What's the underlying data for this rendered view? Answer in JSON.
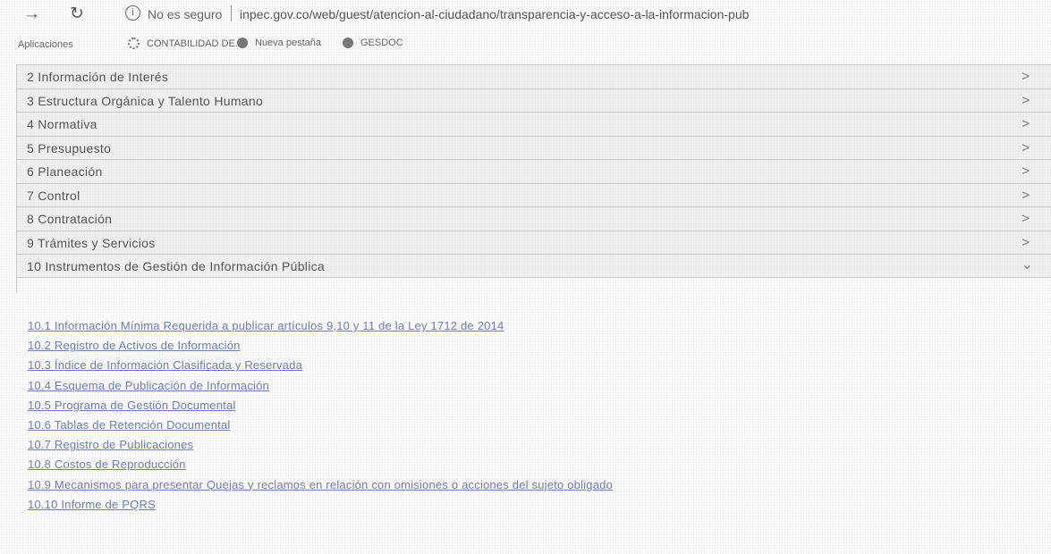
{
  "browser": {
    "back_icon": "back-arrow-icon",
    "reload_icon": "reload-icon",
    "security_text": "No es seguro",
    "url_main": "inpec.gov.co/web/guest/atencion-al-ciudadano/transparencia-y-acceso-a-la-informacion-pub",
    "bookmarks": {
      "apps_label": "Aplicaciones",
      "items": [
        {
          "label": "CONTABILIDAD DE...",
          "icon": "gear-icon"
        },
        {
          "label": "Nueva pestaña",
          "icon": "globe-icon"
        },
        {
          "label": "GESDOC",
          "icon": "globe-icon"
        }
      ]
    }
  },
  "accordion": {
    "items": [
      {
        "label": "2 Información de Interés",
        "chevron": ">"
      },
      {
        "label": "3 Estructura Orgánica y Talento Humano",
        "chevron": ">"
      },
      {
        "label": "4 Normativa",
        "chevron": ">"
      },
      {
        "label": "5 Presupuesto",
        "chevron": ">"
      },
      {
        "label": "6 Planeación",
        "chevron": ">"
      },
      {
        "label": "7 Control",
        "chevron": ">"
      },
      {
        "label": "8 Contratación",
        "chevron": ">"
      },
      {
        "label": "9 Trámites y Servicios",
        "chevron": ">"
      },
      {
        "label": "10 Instrumentos de Gestión de Información Pública",
        "chevron": "⌄"
      }
    ]
  },
  "links": [
    "10.1 Información Mínima Requerida a publicar artículos 9,10 y 11 de la Ley 1712 de 2014",
    "10.2 Registro de Activos de Información",
    "10.3 Índice de Información Clasificada y Reservada",
    "10.4 Esquema de Publicación de Información",
    "10.5 Programa de Gestión Documental",
    "10.6 Tablas de Retención Documental",
    "10.7 Registro de Publicaciones",
    "10.8 Costos de Reproducción",
    "10.9 Mecanismos para presentar Quejas y reclamos en relación con omisiones o acciones del sujeto obligado",
    "10.10 Informe de PQRS"
  ]
}
